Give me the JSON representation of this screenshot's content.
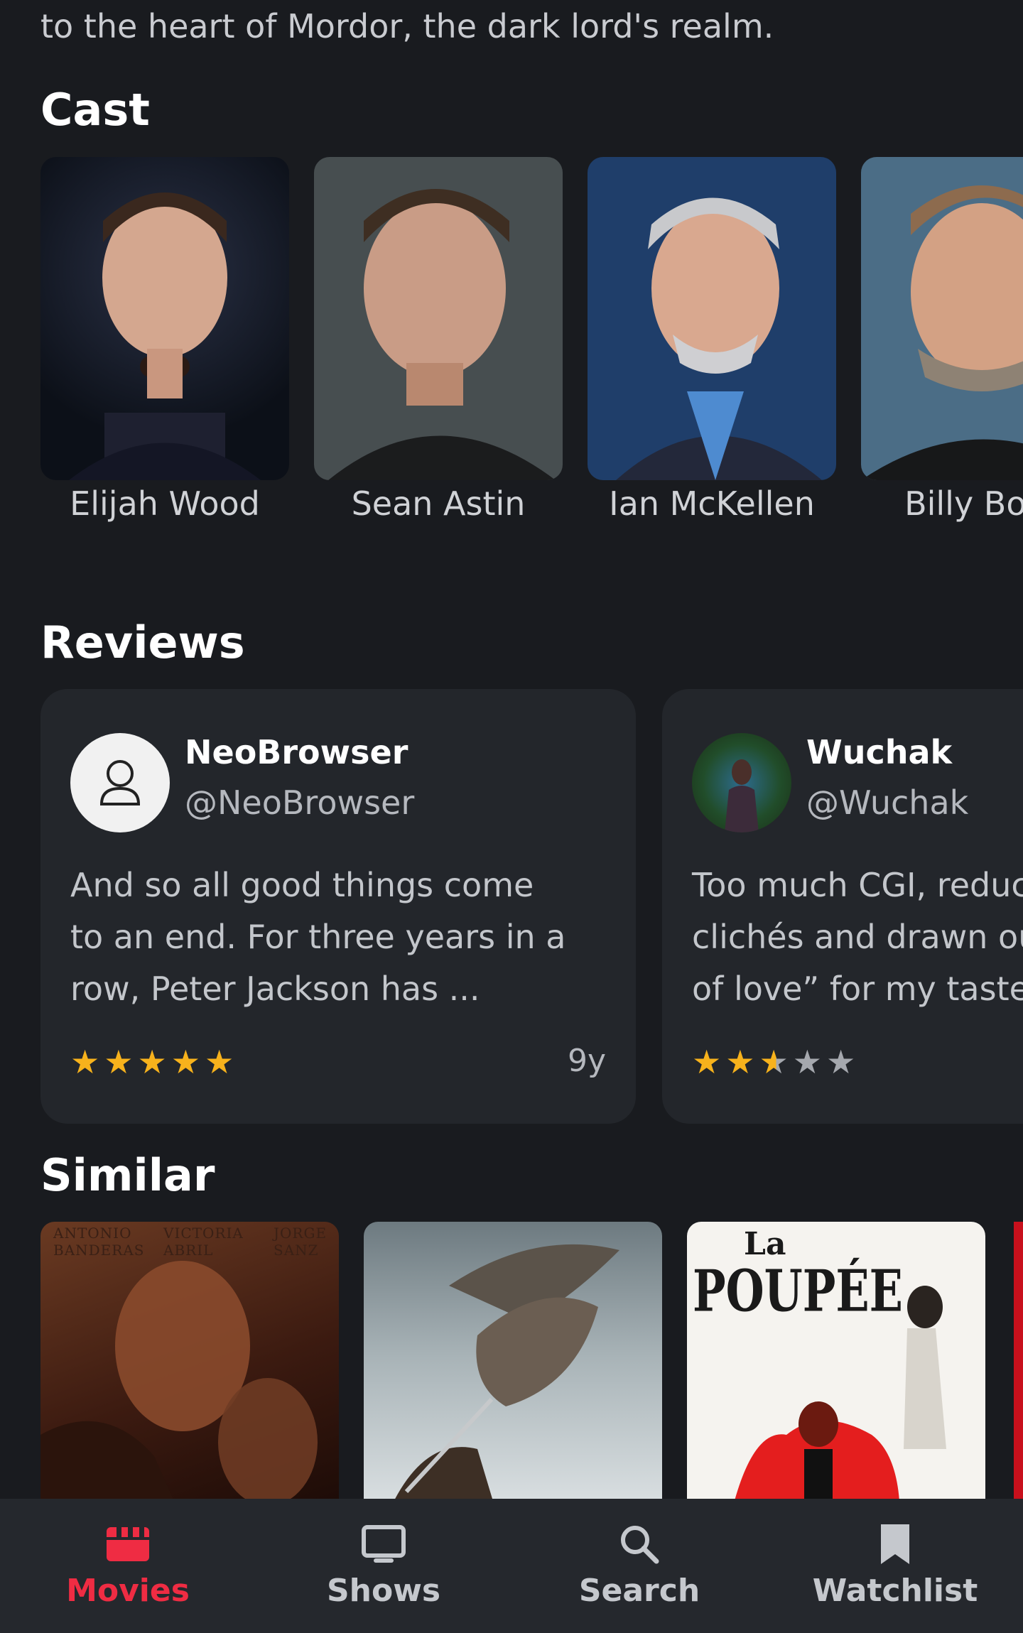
{
  "overview": {
    "text": "to the heart of Mordor, the dark lord's realm."
  },
  "sections": {
    "cast": "Cast",
    "reviews": "Reviews",
    "similar": "Similar"
  },
  "cast": [
    {
      "name": "Elijah Wood"
    },
    {
      "name": "Sean Astin"
    },
    {
      "name": "Ian McKellen"
    },
    {
      "name": "Billy Boyd"
    }
  ],
  "reviews": [
    {
      "author": "NeoBrowser",
      "handle": "@NeoBrowser",
      "text": "And so all good things come\nto an end. For three years in a\nrow, Peter Jackson has ...",
      "rating": 5,
      "age": "9y",
      "avatar": "user-outline-icon"
    },
    {
      "author": "Wuchak",
      "handle": "@Wuchak",
      "text": "Too much CGI, reduced\nclichés and drawn out\nof love” for my taste",
      "rating": 2.5,
      "age": "",
      "avatar": "photo"
    }
  ],
  "similar": [
    {
      "credits": [
        "ANTONIO BANDERAS",
        "VICTORIA ABRIL",
        "JORGE SANZ"
      ]
    },
    {
      "credits": []
    },
    {
      "title_line1": "La",
      "title_line2": "POUPÉE"
    }
  ],
  "nav": [
    {
      "label": "Movies",
      "icon": "clapperboard-icon",
      "active": true
    },
    {
      "label": "Shows",
      "icon": "tv-icon",
      "active": false
    },
    {
      "label": "Search",
      "icon": "search-icon",
      "active": false
    },
    {
      "label": "Watchlist",
      "icon": "bookmark-icon",
      "active": false
    }
  ],
  "colors": {
    "background": "#191b1f",
    "card": "#23262b",
    "accent": "#ef2c43",
    "star": "#f7b21c"
  }
}
